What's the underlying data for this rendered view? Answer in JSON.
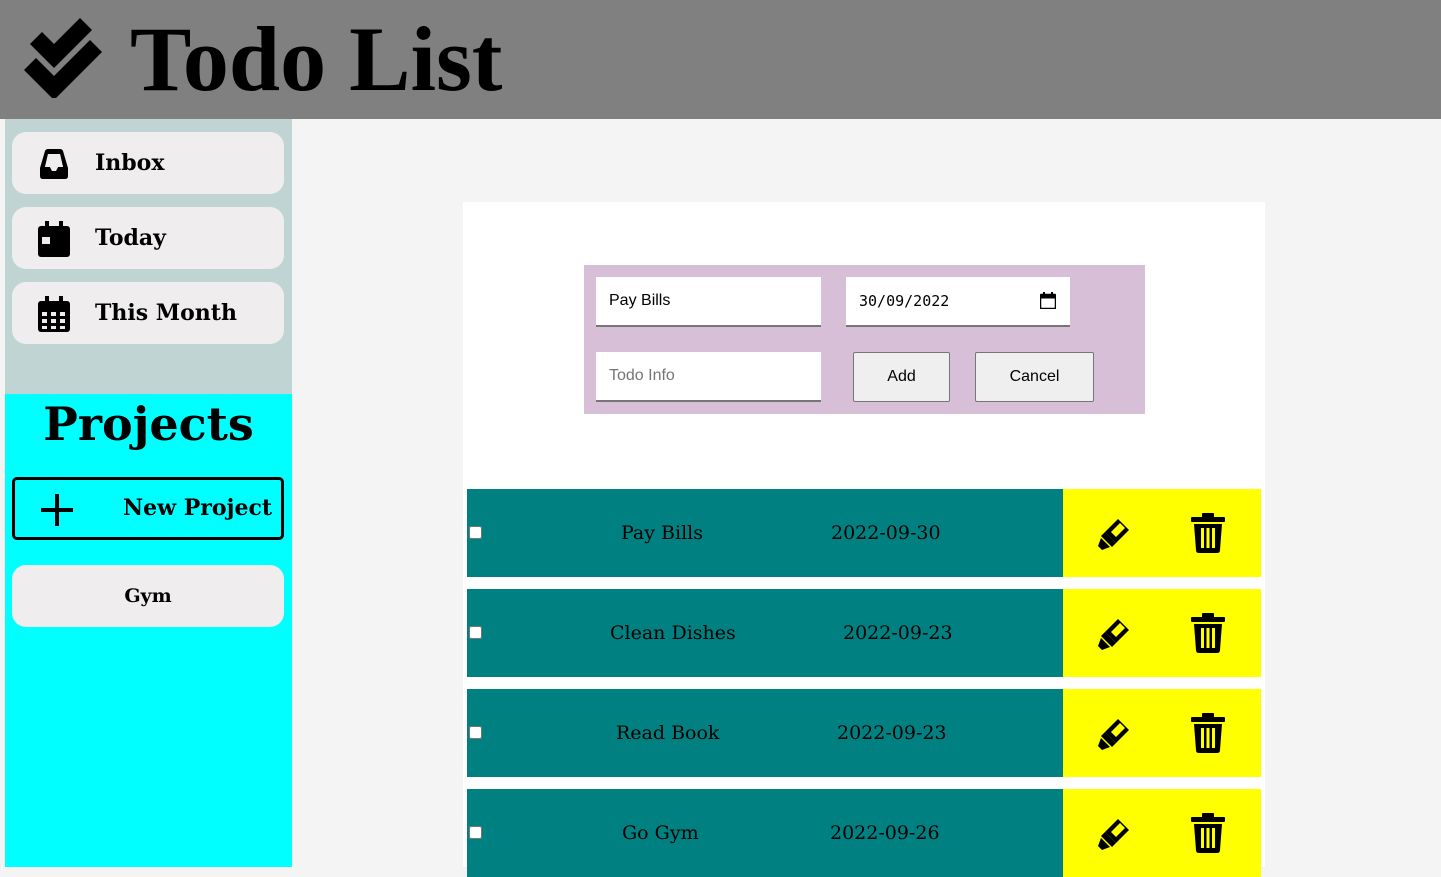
{
  "header": {
    "title": "Todo List",
    "logo_icon": "double-check-icon"
  },
  "nav": {
    "items": [
      {
        "label": "Inbox",
        "icon": "inbox-icon"
      },
      {
        "label": "Today",
        "icon": "calendar-day-icon"
      },
      {
        "label": "This Month",
        "icon": "calendar-month-icon"
      }
    ]
  },
  "projects": {
    "title": "Projects",
    "new_project_label": "New Project",
    "items": [
      {
        "label": "Gym"
      }
    ]
  },
  "form": {
    "title_value": "Pay Bills",
    "date_value": "30/09/2022",
    "info_placeholder": "Todo Info",
    "add_label": "Add",
    "cancel_label": "Cancel"
  },
  "todos": [
    {
      "title": "Pay Bills",
      "date": "2022-09-30",
      "checked": false
    },
    {
      "title": "Clean Dishes",
      "date": "2022-09-23",
      "checked": false
    },
    {
      "title": "Read Book",
      "date": "2022-09-23",
      "checked": false
    },
    {
      "title": "Go Gym",
      "date": "2022-09-26",
      "checked": false
    }
  ],
  "colors": {
    "header_bg": "#808080",
    "nav_bg": "#c0d4d4",
    "projects_bg": "#00ffff",
    "form_bg": "#d8bfd8",
    "todo_row_bg": "#008080",
    "todo_actions_bg": "#ffff00"
  }
}
